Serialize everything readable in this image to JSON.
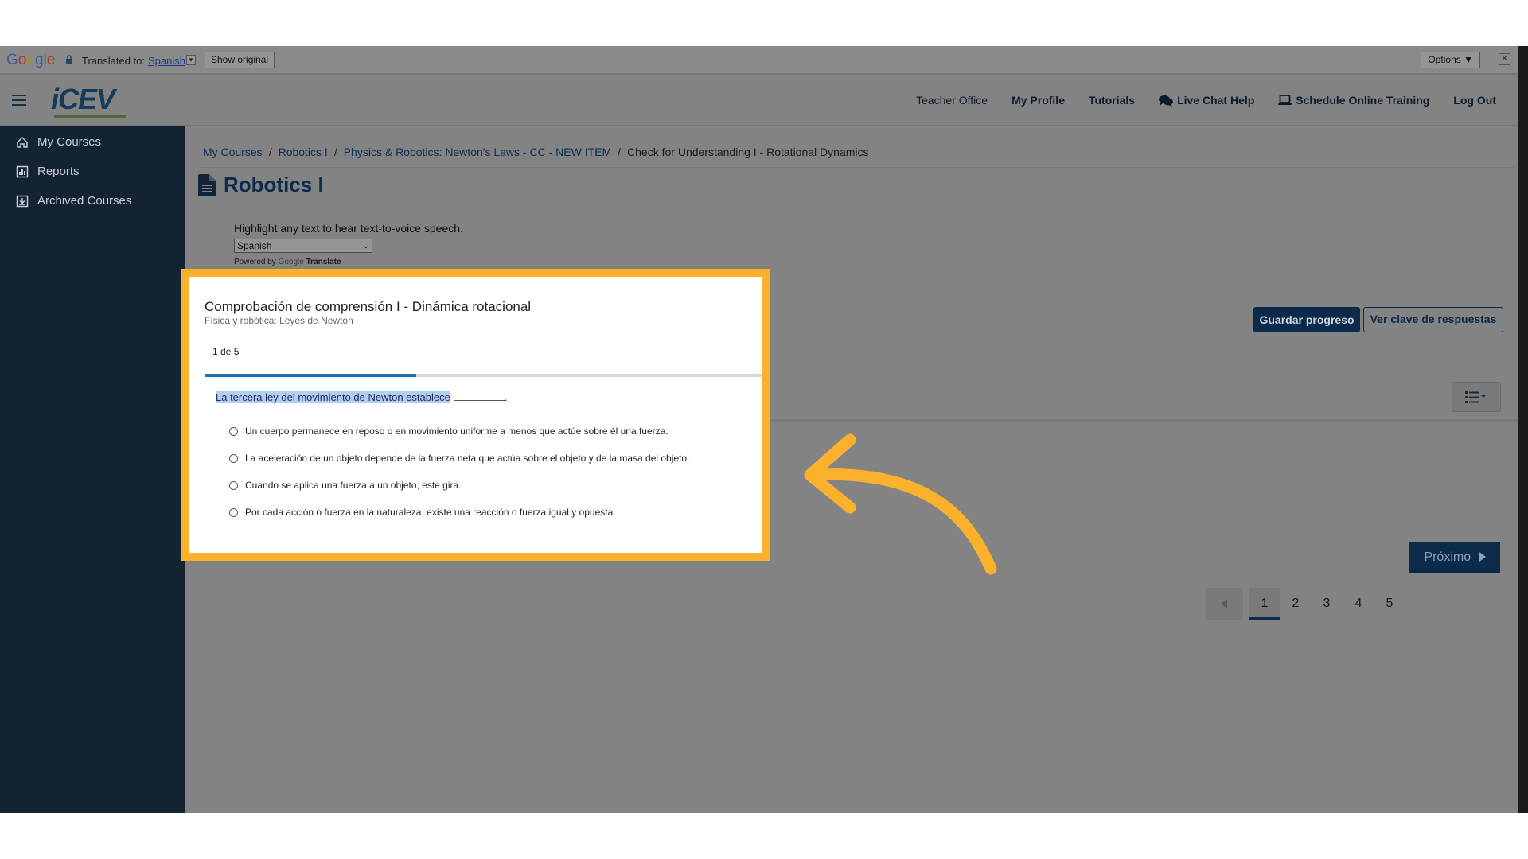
{
  "translate_bar": {
    "logo": "Google",
    "translated_to": "Translated to:",
    "language": "Spanish",
    "show_original": "Show original",
    "options": "Options ▼"
  },
  "header": {
    "logo": "iCEV",
    "nav": [
      {
        "label": "Teacher Office",
        "bold": false
      },
      {
        "label": "My Profile",
        "bold": true
      },
      {
        "label": "Tutorials",
        "bold": true
      },
      {
        "label": "Live Chat Help",
        "bold": true,
        "icon": "chat-icon"
      },
      {
        "label": "Schedule Online Training",
        "bold": true,
        "icon": "laptop-icon"
      },
      {
        "label": "Log Out",
        "bold": true
      }
    ]
  },
  "sidebar": {
    "items": [
      {
        "label": "My Courses",
        "icon": "home-icon"
      },
      {
        "label": "Reports",
        "icon": "chart-icon"
      },
      {
        "label": "Archived Courses",
        "icon": "archive-icon"
      }
    ]
  },
  "breadcrumb": {
    "items": [
      "My Courses",
      "Robotics I",
      "Physics & Robotics: Newton's Laws - CC - NEW ITEM"
    ],
    "current": "Check for Understanding I - Rotational Dynamics"
  },
  "page": {
    "title": "Robotics I",
    "tts_text": "Highlight any text to hear text-to-voice speech.",
    "language_select": "Spanish",
    "powered_by": "Powered by",
    "powered_google": "Google",
    "powered_translate": "Translate",
    "save_button": "Guardar progreso",
    "answer_key_button": "Ver clave de respuestas"
  },
  "quiz": {
    "title": "Comprobación de comprensión I - Dinámica rotacional",
    "subtitle": "Física y robótica: Leyes de Newton",
    "counter": "1 de 5",
    "progress_fraction": 0.38,
    "question_highlight": "La tercera ley del movimiento de Newton establece",
    "question_tail": ".",
    "options": [
      "Un cuerpo permanece en reposo o en movimiento uniforme a menos que actúe sobre él una fuerza.",
      "La aceleración de un objeto depende de la fuerza neta que actúa sobre el objeto y de la masa del objeto.",
      "Cuando se aplica una fuerza a un objeto, este gira.",
      "Por cada acción o fuerza en la naturaleza, existe una reacción o fuerza igual y opuesta."
    ]
  },
  "pagination": {
    "pages": [
      "1",
      "2",
      "3",
      "4",
      "5"
    ],
    "active": "1",
    "next": "Próximo"
  },
  "colors": {
    "highlight_frame": "#fbb12b",
    "arrow": "#fbb12b",
    "primary": "#0c2b4b",
    "sidebar": "#132333",
    "progress": "#1c6fb8"
  }
}
